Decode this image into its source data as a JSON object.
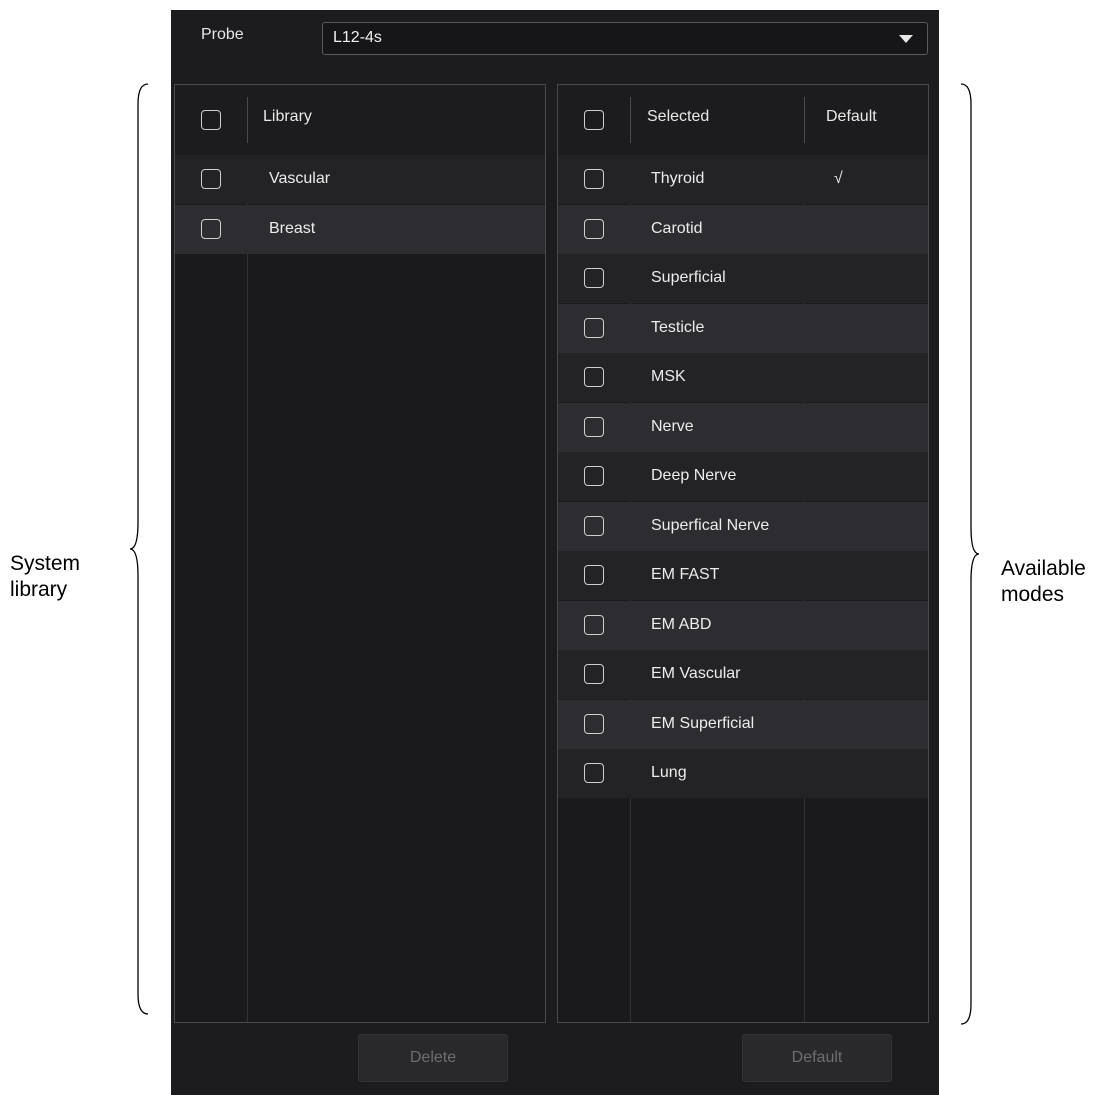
{
  "probe": {
    "label": "Probe",
    "value": "L12-4s"
  },
  "library": {
    "header": "Library",
    "items": [
      "Vascular",
      "Breast"
    ]
  },
  "selected": {
    "header": "Selected",
    "default_header": "Default",
    "items": [
      {
        "name": "Thyroid",
        "default": "√"
      },
      {
        "name": "Carotid",
        "default": ""
      },
      {
        "name": "Superficial",
        "default": ""
      },
      {
        "name": "Testicle",
        "default": ""
      },
      {
        "name": "MSK",
        "default": ""
      },
      {
        "name": "Nerve",
        "default": ""
      },
      {
        "name": "Deep Nerve",
        "default": ""
      },
      {
        "name": "Superfical Nerve",
        "default": ""
      },
      {
        "name": "EM FAST",
        "default": ""
      },
      {
        "name": "EM ABD",
        "default": ""
      },
      {
        "name": "EM Vascular",
        "default": ""
      },
      {
        "name": "EM Superficial",
        "default": ""
      },
      {
        "name": "Lung",
        "default": ""
      }
    ]
  },
  "buttons": {
    "delete": "Delete",
    "default": "Default"
  },
  "annotations": {
    "left_line1": "System",
    "left_line2": "library",
    "right_line1": "Available",
    "right_line2": "modes"
  }
}
